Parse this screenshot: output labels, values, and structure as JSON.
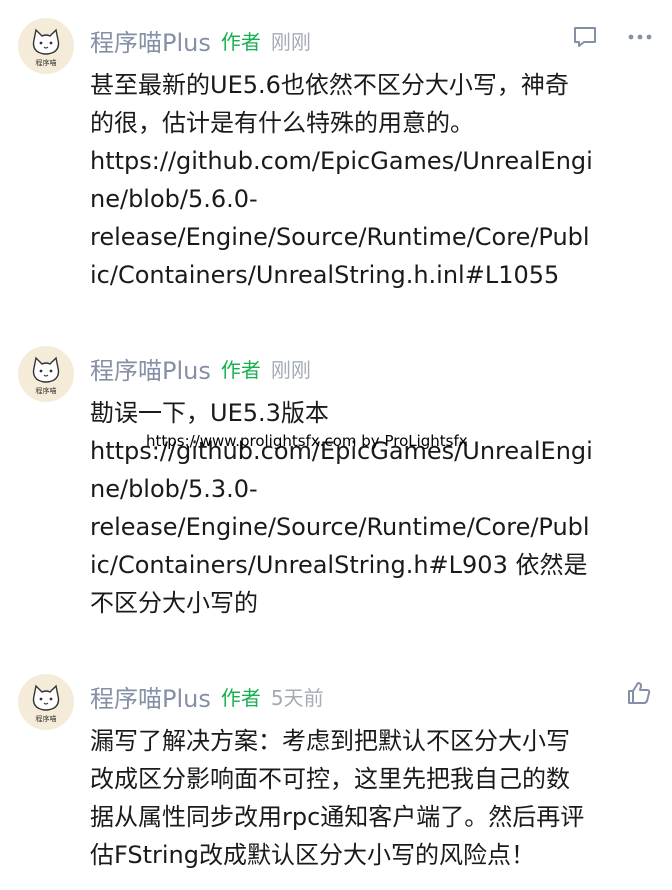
{
  "comments": [
    {
      "author": "程序喵Plus",
      "badge": "作者",
      "time": "刚刚",
      "lines": [
        "甚至最新的UE5.6也依然不区分大小写，神奇",
        "的很，估计是有什么特殊的用意的。",
        "https://github.com/EpicGames/UnrealEngi",
        "ne/blob/5.6.0-",
        "release/Engine/Source/Runtime/Core/Publ",
        "ic/Containers/UnrealString.h.inl#L1055"
      ],
      "icons": [
        "comment-icon",
        "more-icon"
      ]
    },
    {
      "author": "程序喵Plus",
      "badge": "作者",
      "time": "刚刚",
      "lines": [
        "勘误一下，UE5.3版本",
        "https://github.com/EpicGames/UnrealEngi",
        "ne/blob/5.3.0-",
        "release/Engine/Source/Runtime/Core/Publ",
        "ic/Containers/UnrealString.h#L903 依然是",
        "不区分大小写的"
      ],
      "icons": []
    },
    {
      "author": "程序喵Plus",
      "badge": "作者",
      "time": "5天前",
      "lines": [
        "漏写了解决方案：考虑到把默认不区分大小写",
        "改成区分影响面不可控，这里先把我自己的数",
        "据从属性同步改用rpc通知客户端了。然后再评",
        "估FString改成默认区分大小写的风险点！"
      ],
      "icons": [
        "like-icon"
      ]
    }
  ],
  "avatar_caption": "程序喵",
  "watermark": "https://www.prolightsfx.com by ProLightsfx",
  "colors": {
    "author": "#8590a6",
    "badge": "#16b14f",
    "time": "#a5abb6",
    "text": "#1a1a1a"
  }
}
